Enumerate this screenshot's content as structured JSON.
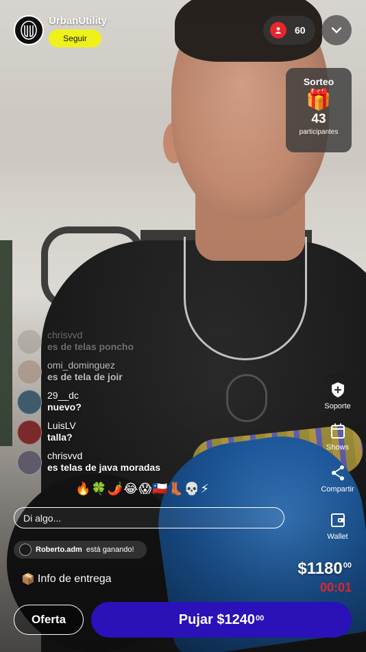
{
  "store": {
    "name": "UrbanUtility",
    "follow_label": "Seguir"
  },
  "viewers": {
    "count": "60"
  },
  "giveaway": {
    "title": "Sorteo",
    "gift": "🎁",
    "count": "43",
    "label": "participantes"
  },
  "chat": [
    {
      "user": "chrisvvd",
      "message": "es de telas poncho",
      "avatar_color": "#8a7f78"
    },
    {
      "user": "omi_dominguez",
      "message": "es de tela de joir",
      "avatar_color": "#a58f80"
    },
    {
      "user": "29__dc",
      "message": "nuevo?",
      "avatar_color": "#3f5b6b"
    },
    {
      "user": "LuisLV",
      "message": "talla?",
      "avatar_color": "#7a2a2a"
    },
    {
      "user": "chrisvvd",
      "message": "es telas de java moradas",
      "avatar_color": "#5e5a6a"
    }
  ],
  "reactions": [
    "🔥",
    "🍀",
    "🌶️",
    "😂",
    "😱",
    "🇨🇱",
    "👢",
    "💀",
    "⚡"
  ],
  "input": {
    "placeholder": "Di algo..."
  },
  "rail": {
    "support": "Soporte",
    "shows": "Shows",
    "share": "Compartir",
    "wallet": "Wallet"
  },
  "winning": {
    "user": "Roberto.adm",
    "text": "está ganando!"
  },
  "delivery": {
    "icon": "📦",
    "label": "Info de entrega"
  },
  "price": {
    "main": "$1180",
    "cents": "00"
  },
  "timer": "00:01",
  "buttons": {
    "offer": "Oferta",
    "bid_main": "Pujar $1240",
    "bid_cents": "00"
  },
  "colors": {
    "accent_yellow": "#eef21a",
    "bid_blue": "#2a11b8",
    "timer_red": "#e0252b",
    "live_red": "#e5262e"
  }
}
